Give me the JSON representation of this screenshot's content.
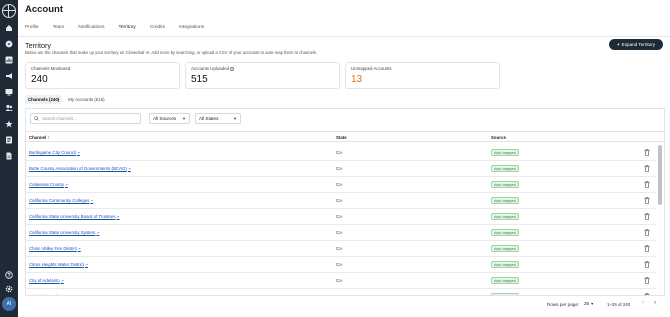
{
  "sidebar": {
    "avatar_initials": "AI",
    "icons": [
      "home-icon",
      "compass-icon",
      "chart-icon",
      "megaphone-icon",
      "monitor-icon",
      "users-icon",
      "star-icon",
      "checklist-icon",
      "document-icon",
      "help-icon",
      "settings-icon"
    ]
  },
  "header": {
    "title": "Account",
    "tabs": [
      "Profile",
      "Team",
      "Notifications",
      "Territory",
      "Credits",
      "Integrations"
    ],
    "active_tab": "Territory"
  },
  "territory": {
    "title": "Territory",
    "description": "Below are the channels that make up your territory on Cloverleaf AI. Add more by searching, or upload a CSV of your accounts to auto-map them to channels.",
    "expand_button": "Expand Territory"
  },
  "stats": [
    {
      "label": "Channels Monitored",
      "value": "240"
    },
    {
      "label": "Accounts Uploaded",
      "value": "515"
    },
    {
      "label": "Unmapped Accounts",
      "value": "13"
    }
  ],
  "subtabs": [
    "Channels (240)",
    "My Accounts (515)"
  ],
  "filters": {
    "search_placeholder": "Search channels...",
    "sources": "All Sources",
    "states": "All States"
  },
  "table": {
    "columns": [
      "Channel",
      "State",
      "Source"
    ],
    "sort_indicator": "↑",
    "rows": [
      {
        "channel": "Burlingame City Council",
        "state": "CA",
        "source": "Auto-mapped"
      },
      {
        "channel": "Butte County Association of Governments (BCAG)",
        "state": "CA",
        "source": "Auto-mapped"
      },
      {
        "channel": "Calaveras County",
        "state": "CA",
        "source": "Auto-mapped"
      },
      {
        "channel": "California Community Colleges",
        "state": "CA",
        "source": "Auto-mapped"
      },
      {
        "channel": "California State University Board of Trustees",
        "state": "CA",
        "source": "Auto-mapped"
      },
      {
        "channel": "California State University System",
        "state": "CA",
        "source": "Auto-mapped"
      },
      {
        "channel": "Chino Valley Fire District",
        "state": "CA",
        "source": "Auto-mapped"
      },
      {
        "channel": "Citrus Heights Water District",
        "state": "CA",
        "source": "Auto-mapped"
      },
      {
        "channel": "City of Adelanto",
        "state": "CA",
        "source": "Auto-mapped"
      },
      {
        "channel": "City of Alameda",
        "state": "CA",
        "source": "Auto-mapped"
      }
    ]
  },
  "pagination": {
    "rows_per_page_label": "Rows per page:",
    "rows_per_page": "25",
    "range": "1–25 of 240"
  }
}
